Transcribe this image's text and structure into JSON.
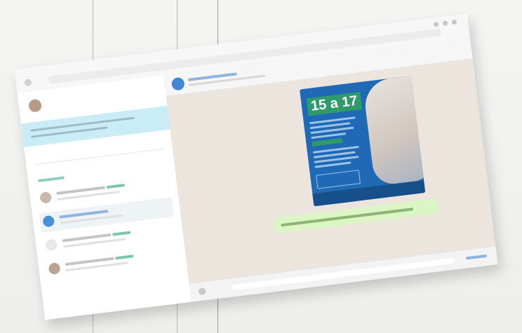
{
  "photo": {
    "description_icon": "photo-of-printed-screenshot"
  },
  "poster": {
    "headline": "15 a 17"
  },
  "colors": {
    "sidebar_banner": "#c9ecf6",
    "poster_bg": "#1f69b5",
    "poster_green": "#2e9b6b",
    "chat_bg": "#ebe5dd",
    "sent_bubble": "#dcf5c4"
  }
}
